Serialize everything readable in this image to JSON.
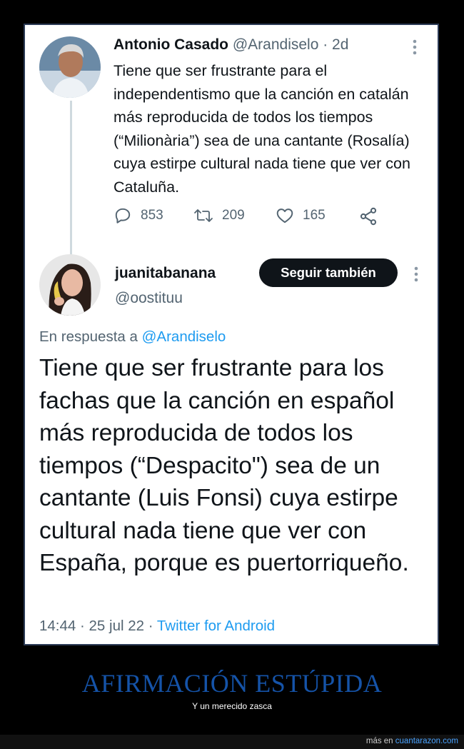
{
  "tweet1": {
    "author_name": "Antonio Casado",
    "handle": "@Arandiselo",
    "age": "· 2d",
    "text": "Tiene que ser frustrante para el independentismo que la canción en catalán más reproducida de todos los tiempos (“Milionària”) sea de una cantante (Rosalía) cuya estirpe cultural nada tiene que ver con Cataluña.",
    "replies": "853",
    "retweets": "209",
    "likes": "165",
    "icons": {
      "reply": "reply-icon",
      "retweet": "retweet-icon",
      "like": "heart-icon",
      "share": "share-icon",
      "menu": "more-icon"
    }
  },
  "tweet2": {
    "author_name": "juanitabanana",
    "handle": "@oostituu",
    "follow_label": "Seguir también",
    "reply_prefix": "En respuesta a",
    "reply_to": "@Arandiselo",
    "text": "Tiene que ser frustrante para los fachas que la canción en español más reproducida de todos los tiempos (“Despacito\") sea de un cantante (Luis Fonsi) cuya estirpe cultural nada tiene que ver con España, porque es puertorriqueño.",
    "timestamp": "14:44 · 25 jul 22 ·",
    "source": "Twitter for Android"
  },
  "headline": "AFIRMACIÓN ESTÚPIDA",
  "subline": "Y un merecido zasca",
  "site": {
    "prefix": "más en",
    "domain": "cuantarazon.com"
  },
  "colors": {
    "link": "#1d9bf0",
    "headline": "#1553a8",
    "muted": "#536471",
    "text": "#0f1419"
  }
}
